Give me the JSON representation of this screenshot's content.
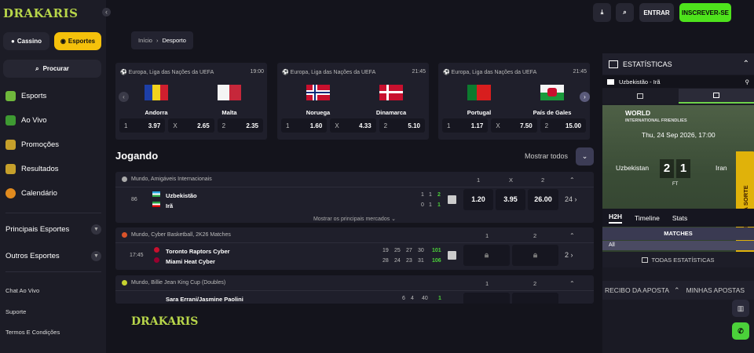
{
  "brand": {
    "logo": "DRAKARIS"
  },
  "sidebar": {
    "collapse": "‹",
    "casino": "Cassino",
    "esportes": "Esportes",
    "search": "Procurar",
    "nav": [
      {
        "label": "Esports",
        "color": "#6fb83c"
      },
      {
        "label": "Ao Vivo",
        "color": "#3e9a32"
      },
      {
        "label": "Promoções",
        "color": "#c6a02b"
      },
      {
        "label": "Resultados",
        "color": "#c6a02b"
      },
      {
        "label": "Calendário",
        "color": "#e08a1e"
      }
    ],
    "sections": [
      "Principais Esportes",
      "Outros Esportes"
    ],
    "links": [
      "Chat Ao Vivo",
      "Suporte",
      "Termos E Condições"
    ]
  },
  "topbar": {
    "entrar": "ENTRAR",
    "inscrever": "INSCREVER-SE"
  },
  "breadcrumb": {
    "home": "Início",
    "sep": "›",
    "current": "Desporto"
  },
  "featured": [
    {
      "league": "Europa, Liga das Nações da UEFA",
      "time": "19:00",
      "home": "Andorra",
      "away": "Malta",
      "o1": "3.97",
      "ox": "2.65",
      "o2": "2.35"
    },
    {
      "league": "Europa, Liga das Nações da UEFA",
      "time": "21:45",
      "home": "Noruega",
      "away": "Dinamarca",
      "o1": "1.60",
      "ox": "4.33",
      "o2": "5.10"
    },
    {
      "league": "Europa, Liga das Nações da UEFA",
      "time": "21:45",
      "home": "Portugal",
      "away": "País de Gales",
      "o1": "1.17",
      "ox": "7.50",
      "o2": "15.00"
    }
  ],
  "odds_labels": {
    "one": "1",
    "x": "X",
    "two": "2"
  },
  "live": {
    "title": "Jogando",
    "show_all": "Mostrar todos",
    "show_markets": "Mostrar os principais mercados ⌄"
  },
  "matches": [
    {
      "league": "Mundo, Amigáveis Internacionais",
      "minute": "86",
      "home": "Uzbekistão",
      "away": "Irã",
      "home_scores": [
        "1",
        "1",
        "2"
      ],
      "away_scores": [
        "0",
        "1",
        "1"
      ],
      "odds": [
        "1.20",
        "3.95",
        "26.00"
      ],
      "more": "24 ›"
    },
    {
      "league": "Mundo, Cyber Basketball, 2K26 Matches",
      "minute": "17:45",
      "home": "Toronto Raptors Cyber",
      "away": "Miami Heat Cyber",
      "home_scores": [
        "19",
        "25",
        "27",
        "30",
        "101"
      ],
      "away_scores": [
        "28",
        "24",
        "23",
        "31",
        "106"
      ],
      "more": "2 ›"
    },
    {
      "league": "Mundo, Billie Jean King Cup (Doubles)",
      "home": "Sara Errani/Jasmine Paolini",
      "home_scores": [
        "6",
        "4",
        "40",
        "1"
      ]
    }
  ],
  "right_panel": {
    "title": "ESTATÍSTICAS",
    "match": "Uzbekistão - Irã",
    "comp": "WORLD",
    "sub": "INTERNATIONAL FRIENDLIES",
    "date": "Thu, 24 Sep 2026, 17:00",
    "home": "Uzbekistan",
    "away": "Iran",
    "score_home": "2",
    "score_away": "1",
    "status": "FT",
    "giro": "GIRO DA SORTE",
    "tabs": [
      "H2H",
      "Timeline",
      "Stats"
    ],
    "matches_header": "MATCHES",
    "all": "All",
    "all_stats": "TODAS ESTATÍSTICAS",
    "bet_slip": "RECIBO DA APOSTA",
    "my_bets": "MINHAS APOSTAS"
  },
  "colors": {
    "accent_yellow": "#f5c10b",
    "accent_green": "#4ee31c",
    "live_green": "#4bd13a"
  }
}
